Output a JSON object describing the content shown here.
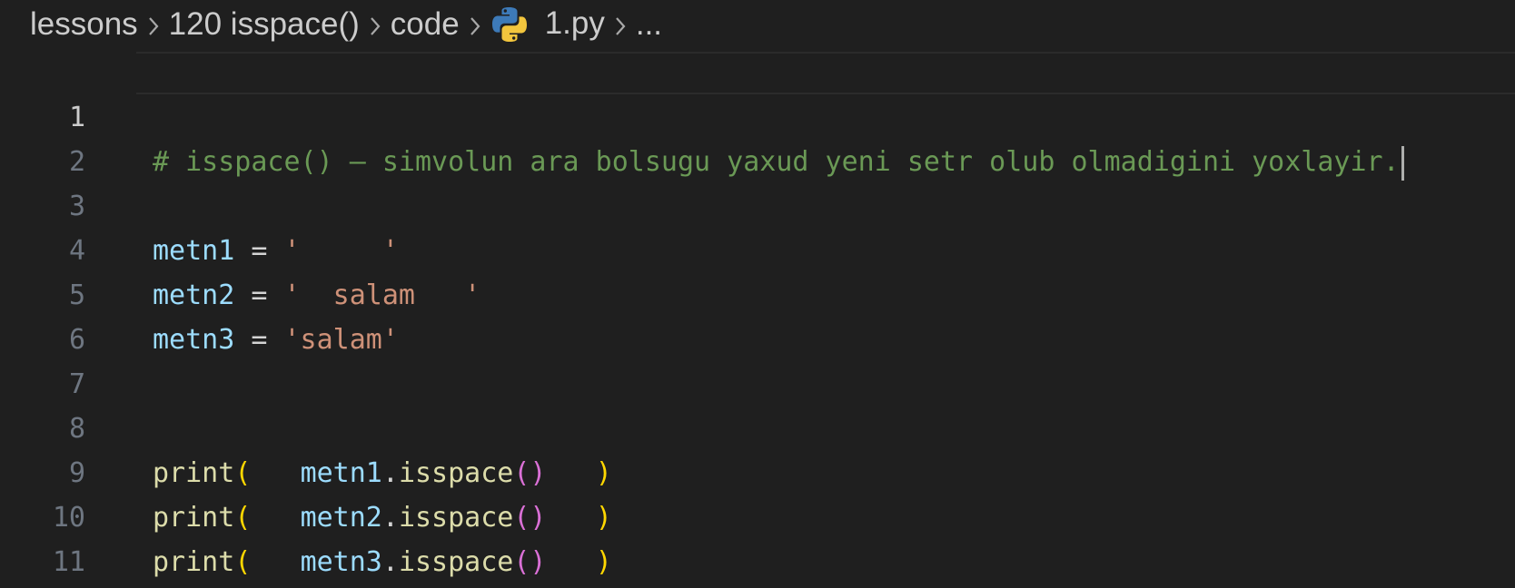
{
  "breadcrumb": {
    "items": [
      "lessons",
      "120 isspace()",
      "code",
      "1.py",
      "..."
    ],
    "file_icon": "python-icon"
  },
  "editor": {
    "lines": [
      {
        "number": "1",
        "comment": "# isspace() – simvolun ara bolsugu yaxud yeni setr olub olmadigini yoxlayir."
      },
      {
        "number": "2"
      },
      {
        "number": "3",
        "var": "metn1",
        "op": " = ",
        "str": "'     '"
      },
      {
        "number": "4",
        "var": "metn2",
        "op": " = ",
        "str": "'  salam   '"
      },
      {
        "number": "5",
        "var": "metn3",
        "op": " = ",
        "str": "'salam'"
      },
      {
        "number": "6"
      },
      {
        "number": "7"
      },
      {
        "number": "8",
        "fn": "print",
        "var": "metn1",
        "method": "isspace"
      },
      {
        "number": "9",
        "fn": "print",
        "var": "metn2",
        "method": "isspace"
      },
      {
        "number": "10",
        "fn": "print",
        "var": "metn3",
        "method": "isspace"
      },
      {
        "number": "11"
      }
    ],
    "colors": {
      "background": "#1f1f1f",
      "comment": "#6a9955",
      "variable": "#9cdcfe",
      "string": "#ce9178",
      "function": "#dcdcaa",
      "bracket_level1": "#ffd700",
      "bracket_level2": "#da70d6"
    }
  }
}
